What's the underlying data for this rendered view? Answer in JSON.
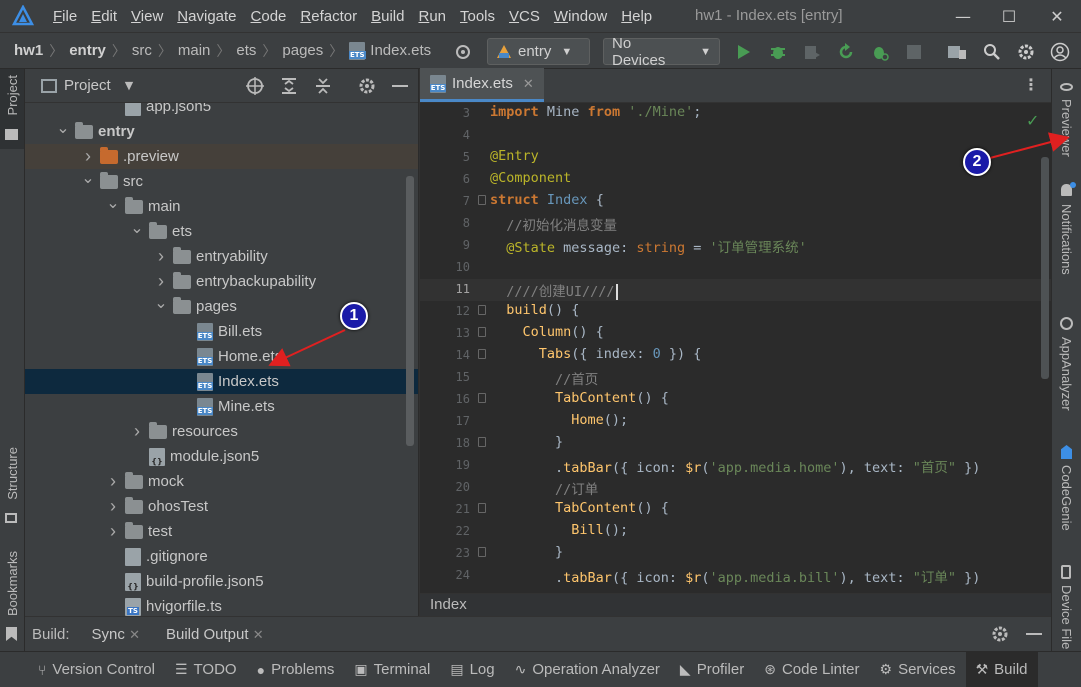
{
  "menu": [
    "File",
    "Edit",
    "View",
    "Navigate",
    "Code",
    "Refactor",
    "Build",
    "Run",
    "Tools",
    "VCS",
    "Window",
    "Help"
  ],
  "window_title": "hw1 - Index.ets [entry]",
  "breadcrumb": [
    "hw1",
    "entry",
    "src",
    "main",
    "ets",
    "pages",
    "Index.ets"
  ],
  "toolbar": {
    "module": "entry",
    "device": "No Devices"
  },
  "project_panel": {
    "title": "Project"
  },
  "tree": [
    {
      "label": "app.json5",
      "depth": 3,
      "icon": "file",
      "arrow": ""
    },
    {
      "label": "entry",
      "depth": 1,
      "icon": "folder",
      "arrow": "down",
      "bold": true
    },
    {
      "label": ".preview",
      "depth": 2,
      "icon": "folder-orange",
      "arrow": "right",
      "highlight": true
    },
    {
      "label": "src",
      "depth": 2,
      "icon": "folder",
      "arrow": "down"
    },
    {
      "label": "main",
      "depth": 3,
      "icon": "folder",
      "arrow": "down"
    },
    {
      "label": "ets",
      "depth": 4,
      "icon": "folder",
      "arrow": "down"
    },
    {
      "label": "entryability",
      "depth": 5,
      "icon": "folder",
      "arrow": "right"
    },
    {
      "label": "entrybackupability",
      "depth": 5,
      "icon": "folder",
      "arrow": "right"
    },
    {
      "label": "pages",
      "depth": 5,
      "icon": "folder",
      "arrow": "down"
    },
    {
      "label": "Bill.ets",
      "depth": 6,
      "icon": "ets",
      "arrow": ""
    },
    {
      "label": "Home.ets",
      "depth": 6,
      "icon": "ets",
      "arrow": ""
    },
    {
      "label": "Index.ets",
      "depth": 6,
      "icon": "ets",
      "arrow": "",
      "selected": true
    },
    {
      "label": "Mine.ets",
      "depth": 6,
      "icon": "ets",
      "arrow": ""
    },
    {
      "label": "resources",
      "depth": 4,
      "icon": "folder",
      "arrow": "right"
    },
    {
      "label": "module.json5",
      "depth": 4,
      "icon": "json",
      "arrow": ""
    },
    {
      "label": "mock",
      "depth": 3,
      "icon": "folder",
      "arrow": "right"
    },
    {
      "label": "ohosTest",
      "depth": 3,
      "icon": "folder",
      "arrow": "right"
    },
    {
      "label": "test",
      "depth": 3,
      "icon": "folder",
      "arrow": "right"
    },
    {
      "label": ".gitignore",
      "depth": 3,
      "icon": "file",
      "arrow": ""
    },
    {
      "label": "build-profile.json5",
      "depth": 3,
      "icon": "json",
      "arrow": ""
    },
    {
      "label": "hvigorfile.ts",
      "depth": 3,
      "icon": "ts",
      "arrow": ""
    }
  ],
  "editor": {
    "tab": "Index.ets",
    "bottom_crumb": "Index",
    "lines": [
      {
        "n": "3",
        "html": "<span class='kw'>import</span> Mine <span class='kw'>from</span> <span class='st'>'./Mine'</span>;"
      },
      {
        "n": "4",
        "html": ""
      },
      {
        "n": "5",
        "html": "<span class='an'>@Entry</span>"
      },
      {
        "n": "6",
        "html": "<span class='an'>@Component</span>"
      },
      {
        "n": "7",
        "html": "<span class='kw'>struct</span> <span class='ty'>Index</span> {"
      },
      {
        "n": "8",
        "html": "  <span class='cm'>//初始化消息变量</span>"
      },
      {
        "n": "9",
        "html": "  <span class='an'>@State</span> message: <span class='kw' style='font-weight:normal'>string</span> = <span class='st'>'订单管理系统'</span>"
      },
      {
        "n": "10",
        "html": ""
      },
      {
        "n": "11",
        "html": "  <span class='cm'>////创建UI////</span>",
        "current": true
      },
      {
        "n": "12",
        "html": "  <span class='fn'>build</span>() {"
      },
      {
        "n": "13",
        "html": "    <span class='fn'>Column</span>() {"
      },
      {
        "n": "14",
        "html": "      <span class='fn'>Tabs</span>({ index: <span class='ty'>0</span> }) {"
      },
      {
        "n": "15",
        "html": "        <span class='cm'>//首页</span>"
      },
      {
        "n": "16",
        "html": "        <span class='fn'>TabContent</span>() {"
      },
      {
        "n": "17",
        "html": "          <span class='fn'>Home</span>();"
      },
      {
        "n": "18",
        "html": "        }"
      },
      {
        "n": "19",
        "html": "        .<span class='fn'>tabBar</span>({ icon: <span class='fn'>$r</span>(<span class='st'>'app.media.home'</span>), text: <span class='st'>\"首页\"</span> })"
      },
      {
        "n": "20",
        "html": "        <span class='cm'>//订单</span>"
      },
      {
        "n": "21",
        "html": "        <span class='fn'>TabContent</span>() {"
      },
      {
        "n": "22",
        "html": "          <span class='fn'>Bill</span>();"
      },
      {
        "n": "23",
        "html": "        }"
      },
      {
        "n": "24",
        "html": "        .<span class='fn'>tabBar</span>({ icon: <span class='fn'>$r</span>(<span class='st'>'app.media.bill'</span>), text: <span class='st'>\"订单\"</span> })"
      }
    ]
  },
  "left_tools": {
    "project": "Project",
    "structure": "Structure",
    "bookmarks": "Bookmarks"
  },
  "right_tools": [
    "Previewer",
    "Notifications",
    "AppAnalyzer",
    "CodeGenie",
    "Device File"
  ],
  "build_bar": {
    "label": "Build:",
    "tabs": [
      "Sync",
      "Build Output"
    ]
  },
  "status_items": [
    "Version Control",
    "TODO",
    "Problems",
    "Terminal",
    "Log",
    "Operation Analyzer",
    "Profiler",
    "Code Linter",
    "Services",
    "Build"
  ],
  "annotations": [
    "1",
    "2"
  ],
  "colors": {
    "accent": "#4a88c7",
    "selected_row": "#0d293e",
    "badge": "#1a1aa8",
    "arrow": "#e02020"
  }
}
